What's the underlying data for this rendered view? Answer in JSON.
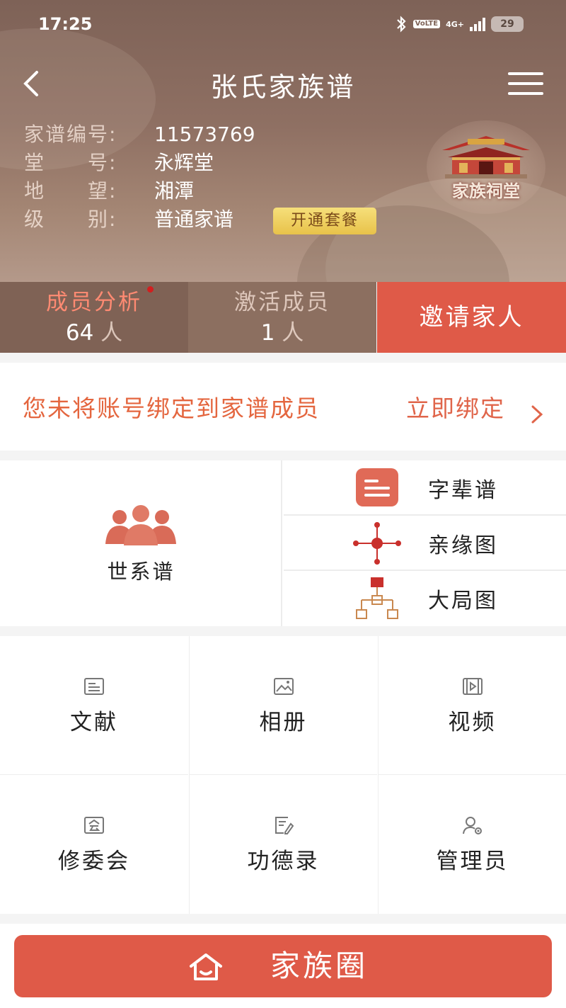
{
  "status_bar": {
    "time": "17:25",
    "network_badge": "VoLTE",
    "network_type": "4G+",
    "battery": "29"
  },
  "header": {
    "title": "张氏家族谱",
    "back_icon": "chevron-left-icon",
    "menu_icon": "hamburger-menu-icon"
  },
  "genealogy_info": {
    "rows": [
      {
        "label": "家谱编号:",
        "value": "11573769"
      },
      {
        "label": "堂　　号:",
        "value": "永辉堂"
      },
      {
        "label": "地　　望:",
        "value": "湘潭"
      },
      {
        "label": "级　　别:",
        "value": "普通家谱"
      }
    ],
    "plan_button": "开通套餐"
  },
  "ancestral_hall": {
    "label": "家族祠堂"
  },
  "stats": {
    "members_label": "成员分析",
    "members_value": "64",
    "members_unit": "人",
    "active_label": "激活成员",
    "active_value": "1",
    "active_unit": "人",
    "invite_button": "邀请家人"
  },
  "bind_banner": {
    "text": "您未将账号绑定到家谱成员",
    "link": "立即绑定"
  },
  "genealogy_views": {
    "main_label": "世系谱",
    "items": [
      {
        "label": "字辈谱",
        "icon": "list-icon"
      },
      {
        "label": "亲缘图",
        "icon": "network-icon"
      },
      {
        "label": "大局图",
        "icon": "tree-chart-icon"
      }
    ]
  },
  "grid": {
    "items": [
      {
        "label": "文献",
        "icon": "document-icon"
      },
      {
        "label": "相册",
        "icon": "photo-icon"
      },
      {
        "label": "视频",
        "icon": "video-icon"
      },
      {
        "label": "修委会",
        "icon": "committee-icon"
      },
      {
        "label": "功德录",
        "icon": "merit-record-icon"
      },
      {
        "label": "管理员",
        "icon": "admin-icon"
      }
    ]
  },
  "bottom": {
    "button_label": "家族圈"
  },
  "colors": {
    "accent": "#df5a48",
    "warning_text": "#e4663f",
    "header_brown": "#7f6255"
  }
}
